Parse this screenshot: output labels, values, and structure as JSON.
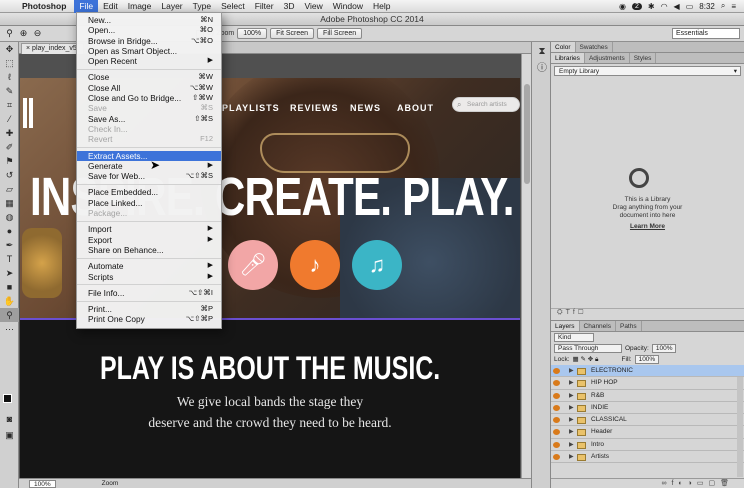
{
  "menubar": {
    "app_name": "Photoshop",
    "items": [
      "File",
      "Edit",
      "Image",
      "Layer",
      "Type",
      "Select",
      "Filter",
      "3D",
      "View",
      "Window",
      "Help"
    ],
    "active": "File",
    "notify_count": "2",
    "time": "8:32"
  },
  "window": {
    "title": "Adobe Photoshop CC 2014"
  },
  "options": {
    "zoom_text": "by Zoom",
    "btn_100": "100%",
    "btn_fit": "Fit Screen",
    "btn_fill": "Fill Screen",
    "workspace": "Essentials"
  },
  "doc": {
    "tab": "play_index_v5"
  },
  "site": {
    "nav": [
      "PLAYLISTS",
      "REVIEWS",
      "NEWS",
      "ABOUT"
    ],
    "search_placeholder": "Search artists",
    "hero_title": "INSPIRE. CREATE. PLAY.",
    "hero_title_visible": "INS  RE. CREATE. PLAY.",
    "h2": "PLAY IS ABOUT THE MUSIC.",
    "sub1": "We give local bands the stage they",
    "sub2": "deserve and the crowd they need to be heard."
  },
  "status": {
    "zoom": "100%",
    "mode": "Zoom"
  },
  "libraries_panel": {
    "top_tabs": [
      "Color",
      "Swatches"
    ],
    "tabs": [
      "Libraries",
      "Adjustments",
      "Styles"
    ],
    "library": "Empty Library",
    "empty_title": "This is a Library",
    "empty_line2": "Drag anything from your",
    "empty_line3": "document into here",
    "learn_more": "Learn More"
  },
  "layers_panel": {
    "tabs": [
      "Layers",
      "Channels",
      "Paths"
    ],
    "filter": "Kind",
    "blend": "Pass Through",
    "opacity_label": "Opacity:",
    "opacity": "100%",
    "lock_label": "Lock:",
    "fill_label": "Fill:",
    "fill": "100%",
    "layers": [
      "ELECTRONIC",
      "HIP HOP",
      "R&B",
      "INDIE",
      "CLASSICAL",
      "Header",
      "Intro",
      "Artists"
    ],
    "selected": "ELECTRONIC"
  },
  "file_menu": {
    "items": [
      {
        "label": "New...",
        "shortcut": "⌘N",
        "enabled": true
      },
      {
        "label": "Open...",
        "shortcut": "⌘O",
        "enabled": true
      },
      {
        "label": "Browse in Bridge...",
        "shortcut": "⌥⌘O",
        "enabled": true
      },
      {
        "label": "Open as Smart Object...",
        "shortcut": "",
        "enabled": true
      },
      {
        "label": "Open Recent",
        "shortcut": "",
        "submenu": true,
        "enabled": true
      },
      {
        "sep": true
      },
      {
        "label": "Close",
        "shortcut": "⌘W",
        "enabled": true
      },
      {
        "label": "Close All",
        "shortcut": "⌥⌘W",
        "enabled": true
      },
      {
        "label": "Close and Go to Bridge...",
        "shortcut": "⇧⌘W",
        "enabled": true
      },
      {
        "label": "Save",
        "shortcut": "⌘S",
        "enabled": false
      },
      {
        "label": "Save As...",
        "shortcut": "⇧⌘S",
        "enabled": true
      },
      {
        "label": "Check In...",
        "shortcut": "",
        "enabled": false
      },
      {
        "label": "Revert",
        "shortcut": "F12",
        "enabled": false
      },
      {
        "sep": true
      },
      {
        "label": "Extract Assets...",
        "shortcut": "",
        "enabled": true,
        "highlighted": true
      },
      {
        "label": "Generate",
        "shortcut": "",
        "submenu": true,
        "enabled": true
      },
      {
        "label": "Save for Web...",
        "shortcut": "⌥⇧⌘S",
        "enabled": true
      },
      {
        "sep": true
      },
      {
        "label": "Place Embedded...",
        "shortcut": "",
        "enabled": true
      },
      {
        "label": "Place Linked...",
        "shortcut": "",
        "enabled": true
      },
      {
        "label": "Package...",
        "shortcut": "",
        "enabled": false
      },
      {
        "sep": true
      },
      {
        "label": "Import",
        "shortcut": "",
        "submenu": true,
        "enabled": true
      },
      {
        "label": "Export",
        "shortcut": "",
        "submenu": true,
        "enabled": true
      },
      {
        "label": "Share on Behance...",
        "shortcut": "",
        "enabled": true
      },
      {
        "sep": true
      },
      {
        "label": "Automate",
        "shortcut": "",
        "submenu": true,
        "enabled": true
      },
      {
        "label": "Scripts",
        "shortcut": "",
        "submenu": true,
        "enabled": true
      },
      {
        "sep": true
      },
      {
        "label": "File Info...",
        "shortcut": "⌥⇧⌘I",
        "enabled": true
      },
      {
        "sep": true
      },
      {
        "label": "Print...",
        "shortcut": "⌘P",
        "enabled": true
      },
      {
        "label": "Print One Copy",
        "shortcut": "⌥⇧⌘P",
        "enabled": true
      }
    ]
  },
  "colors": {
    "menu_highlight": "#3d73d9",
    "layer_selected": "#a9c7ee",
    "accent_pink": "#f2a6a6",
    "accent_orange": "#f07a2e",
    "accent_teal": "#3bb5c6"
  }
}
